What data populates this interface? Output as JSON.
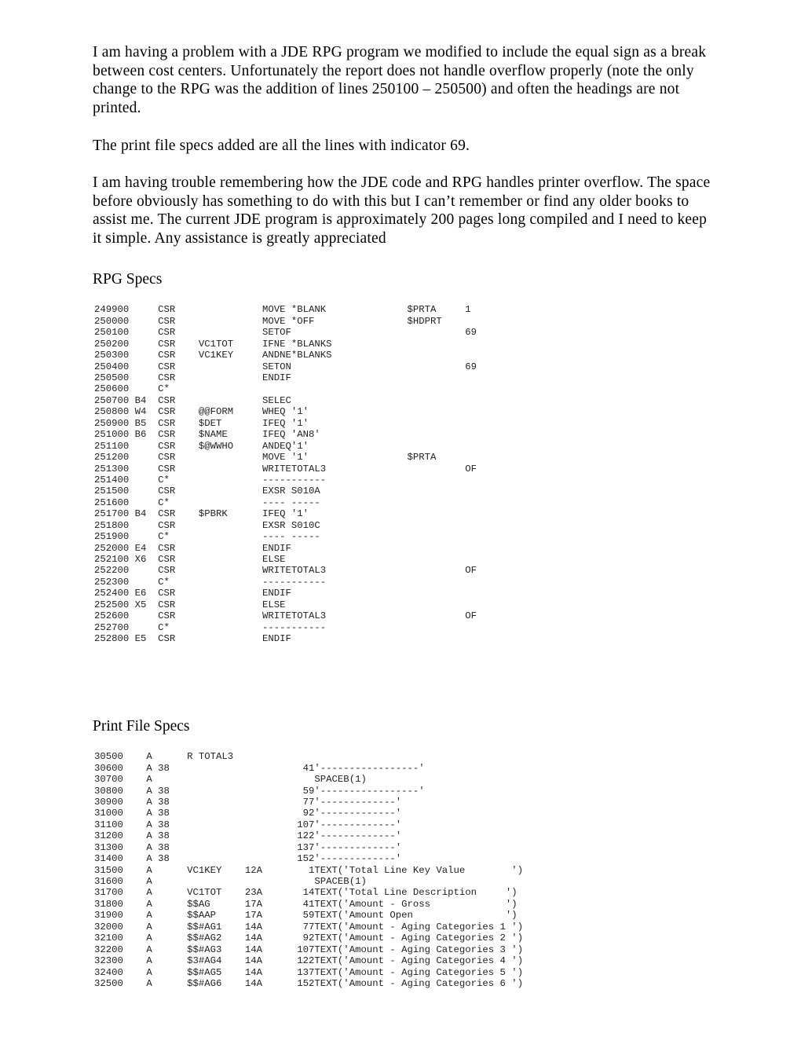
{
  "document": {
    "paragraphs": [
      "I am having a problem with a JDE RPG program we modified to include the equal sign as a break between cost centers.  Unfortunately the report does not handle overflow properly (note the only change to the RPG was the addition of lines 250100 – 250500) and often the headings are not printed.",
      "The print file specs added are all the lines with indicator 69.",
      "I am having trouble remembering how the JDE code and RPG handles printer overflow.  The space before obviously has something to do with this but I can’t remember or find any older books to assist me.  The current JDE program is approximately 200 pages long compiled and I need to keep it simple.  Any assistance is greatly appreciated"
    ],
    "headings": {
      "rpg_specs": "RPG Specs",
      "print_file_specs": "Print File Specs"
    }
  },
  "rpg_listing": {
    "columns": {
      "seq_width": 6,
      "level_width": 2,
      "spec_width": 3,
      "factor1_width": 10,
      "opcode_width": 25,
      "result_width": 10
    },
    "lines": [
      {
        "seq": "249900",
        "level": "",
        "spec": "CSR",
        "factor1": "",
        "opcode": "MOVE *BLANK",
        "result": "$PRTA",
        "indicator": "1"
      },
      {
        "seq": "250000",
        "level": "",
        "spec": "CSR",
        "factor1": "",
        "opcode": "MOVE *OFF",
        "result": "$HDPRT",
        "indicator": ""
      },
      {
        "seq": "250100",
        "level": "",
        "spec": "CSR",
        "factor1": "",
        "opcode": "SETOF",
        "result": "",
        "indicator": "69"
      },
      {
        "seq": "250200",
        "level": "",
        "spec": "CSR",
        "factor1": "VC1TOT",
        "opcode": "IFNE *BLANKS",
        "result": "",
        "indicator": ""
      },
      {
        "seq": "250300",
        "level": "",
        "spec": "CSR",
        "factor1": "VC1KEY",
        "opcode": "ANDNE*BLANKS",
        "result": "",
        "indicator": ""
      },
      {
        "seq": "250400",
        "level": "",
        "spec": "CSR",
        "factor1": "",
        "opcode": "SETON",
        "result": "",
        "indicator": "69"
      },
      {
        "seq": "250500",
        "level": "",
        "spec": "CSR",
        "factor1": "",
        "opcode": "ENDIF",
        "result": "",
        "indicator": ""
      },
      {
        "seq": "250600",
        "level": "",
        "spec": "C*",
        "factor1": "",
        "opcode": "",
        "result": "",
        "indicator": ""
      },
      {
        "seq": "250700",
        "level": "B4",
        "spec": "CSR",
        "factor1": "",
        "opcode": "SELEC",
        "result": "",
        "indicator": ""
      },
      {
        "seq": "250800",
        "level": "W4",
        "spec": "CSR",
        "factor1": "@@FORM",
        "opcode": "WHEQ '1'",
        "result": "",
        "indicator": ""
      },
      {
        "seq": "250900",
        "level": "B5",
        "spec": "CSR",
        "factor1": "$DET",
        "opcode": "IFEQ '1'",
        "result": "",
        "indicator": ""
      },
      {
        "seq": "251000",
        "level": "B6",
        "spec": "CSR",
        "factor1": "$NAME",
        "opcode": "IFEQ 'AN8'",
        "result": "",
        "indicator": ""
      },
      {
        "seq": "251100",
        "level": "",
        "spec": "CSR",
        "factor1": "$@WWHO",
        "opcode": "ANDEQ'1'",
        "result": "",
        "indicator": ""
      },
      {
        "seq": "251200",
        "level": "",
        "spec": "CSR",
        "factor1": "",
        "opcode": "MOVE '1'",
        "result": "$PRTA",
        "indicator": ""
      },
      {
        "seq": "251300",
        "level": "",
        "spec": "CSR",
        "factor1": "",
        "opcode": "WRITETOTAL3",
        "result": "",
        "indicator": "OF"
      },
      {
        "seq": "251400",
        "level": "",
        "spec": "C*",
        "factor1": "",
        "opcode": "-----------",
        "result": "",
        "indicator": ""
      },
      {
        "seq": "251500",
        "level": "",
        "spec": "CSR",
        "factor1": "",
        "opcode": "EXSR S010A",
        "result": "",
        "indicator": ""
      },
      {
        "seq": "251600",
        "level": "",
        "spec": "C*",
        "factor1": "",
        "opcode": "---- -----",
        "result": "",
        "indicator": ""
      },
      {
        "seq": "251700",
        "level": "B4",
        "spec": "CSR",
        "factor1": "$PBRK",
        "opcode": "IFEQ '1'",
        "result": "",
        "indicator": ""
      },
      {
        "seq": "251800",
        "level": "",
        "spec": "CSR",
        "factor1": "",
        "opcode": "EXSR S010C",
        "result": "",
        "indicator": ""
      },
      {
        "seq": "251900",
        "level": "",
        "spec": "C*",
        "factor1": "",
        "opcode": "---- -----",
        "result": "",
        "indicator": ""
      },
      {
        "seq": "252000",
        "level": "E4",
        "spec": "CSR",
        "factor1": "",
        "opcode": "ENDIF",
        "result": "",
        "indicator": ""
      },
      {
        "seq": "252100",
        "level": "X6",
        "spec": "CSR",
        "factor1": "",
        "opcode": "ELSE",
        "result": "",
        "indicator": ""
      },
      {
        "seq": "252200",
        "level": "",
        "spec": "CSR",
        "factor1": "",
        "opcode": "WRITETOTAL3",
        "result": "",
        "indicator": "OF"
      },
      {
        "seq": "252300",
        "level": "",
        "spec": "C*",
        "factor1": "",
        "opcode": "-----------",
        "result": "",
        "indicator": ""
      },
      {
        "seq": "252400",
        "level": "E6",
        "spec": "CSR",
        "factor1": "",
        "opcode": "ENDIF",
        "result": "",
        "indicator": ""
      },
      {
        "seq": "252500",
        "level": "X5",
        "spec": "CSR",
        "factor1": "",
        "opcode": "ELSE",
        "result": "",
        "indicator": ""
      },
      {
        "seq": "252600",
        "level": "",
        "spec": "CSR",
        "factor1": "",
        "opcode": "WRITETOTAL3",
        "result": "",
        "indicator": "OF"
      },
      {
        "seq": "252700",
        "level": "",
        "spec": "C*",
        "factor1": "",
        "opcode": "-----------",
        "result": "",
        "indicator": ""
      },
      {
        "seq": "252800",
        "level": "E5",
        "spec": "CSR",
        "factor1": "",
        "opcode": "ENDIF",
        "result": "",
        "indicator": ""
      }
    ]
  },
  "dds_listing": {
    "columns": {
      "seq_width": 6,
      "spec_width": 1,
      "indicator_width": 2,
      "name_width": 8,
      "length_width": 5,
      "pos_width": 5
    },
    "lines": [
      {
        "seq": "30500",
        "spec": "A",
        "indicator": "",
        "name": "",
        "length": "",
        "pos": "",
        "keyword": "R TOTAL3",
        "inline": true
      },
      {
        "seq": "30600",
        "spec": "A",
        "indicator": "38",
        "name": "",
        "length": "",
        "pos": "41",
        "keyword": "'-----------------'"
      },
      {
        "seq": "30700",
        "spec": "A",
        "indicator": "",
        "name": "",
        "length": "",
        "pos": "",
        "keyword": "SPACEB(1)"
      },
      {
        "seq": "30800",
        "spec": "A",
        "indicator": "38",
        "name": "",
        "length": "",
        "pos": "59",
        "keyword": "'-----------------'"
      },
      {
        "seq": "30900",
        "spec": "A",
        "indicator": "38",
        "name": "",
        "length": "",
        "pos": "77",
        "keyword": "'-------------'"
      },
      {
        "seq": "31000",
        "spec": "A",
        "indicator": "38",
        "name": "",
        "length": "",
        "pos": "92",
        "keyword": "'-------------'"
      },
      {
        "seq": "31100",
        "spec": "A",
        "indicator": "38",
        "name": "",
        "length": "",
        "pos": "107",
        "keyword": "'-------------'"
      },
      {
        "seq": "31200",
        "spec": "A",
        "indicator": "38",
        "name": "",
        "length": "",
        "pos": "122",
        "keyword": "'-------------'"
      },
      {
        "seq": "31300",
        "spec": "A",
        "indicator": "38",
        "name": "",
        "length": "",
        "pos": "137",
        "keyword": "'-------------'"
      },
      {
        "seq": "31400",
        "spec": "A",
        "indicator": "38",
        "name": "",
        "length": "",
        "pos": "152",
        "keyword": "'-------------'"
      },
      {
        "seq": "31500",
        "spec": "A",
        "indicator": "",
        "name": "VC1KEY",
        "length": "12A",
        "pos": "1",
        "keyword": "TEXT('Total Line Key Value        ')"
      },
      {
        "seq": "31600",
        "spec": "A",
        "indicator": "",
        "name": "",
        "length": "",
        "pos": "",
        "keyword": "SPACEB(1)"
      },
      {
        "seq": "31700",
        "spec": "A",
        "indicator": "",
        "name": "VC1TOT",
        "length": "23A",
        "pos": "14",
        "keyword": "TEXT('Total Line Description     ')"
      },
      {
        "seq": "31800",
        "spec": "A",
        "indicator": "",
        "name": "$$AG",
        "length": "17A",
        "pos": "41",
        "keyword": "TEXT('Amount - Gross             ')"
      },
      {
        "seq": "31900",
        "spec": "A",
        "indicator": "",
        "name": "$$AAP",
        "length": "17A",
        "pos": "59",
        "keyword": "TEXT('Amount Open                ')"
      },
      {
        "seq": "32000",
        "spec": "A",
        "indicator": "",
        "name": "$$#AG1",
        "length": "14A",
        "pos": "77",
        "keyword": "TEXT('Amount - Aging Categories 1 ')"
      },
      {
        "seq": "32100",
        "spec": "A",
        "indicator": "",
        "name": "$$#AG2",
        "length": "14A",
        "pos": "92",
        "keyword": "TEXT('Amount - Aging Categories 2 ')"
      },
      {
        "seq": "32200",
        "spec": "A",
        "indicator": "",
        "name": "$$#AG3",
        "length": "14A",
        "pos": "107",
        "keyword": "TEXT('Amount - Aging Categories 3 ')"
      },
      {
        "seq": "32300",
        "spec": "A",
        "indicator": "",
        "name": "$3#AG4",
        "length": "14A",
        "pos": "122",
        "keyword": "TEXT('Amount - Aging Categories 4 ')"
      },
      {
        "seq": "32400",
        "spec": "A",
        "indicator": "",
        "name": "$$#AG5",
        "length": "14A",
        "pos": "137",
        "keyword": "TEXT('Amount - Aging Categories 5 ')"
      },
      {
        "seq": "32500",
        "spec": "A",
        "indicator": "",
        "name": "$$#AG6",
        "length": "14A",
        "pos": "152",
        "keyword": "TEXT('Amount - Aging Categories 6 ')"
      }
    ]
  }
}
